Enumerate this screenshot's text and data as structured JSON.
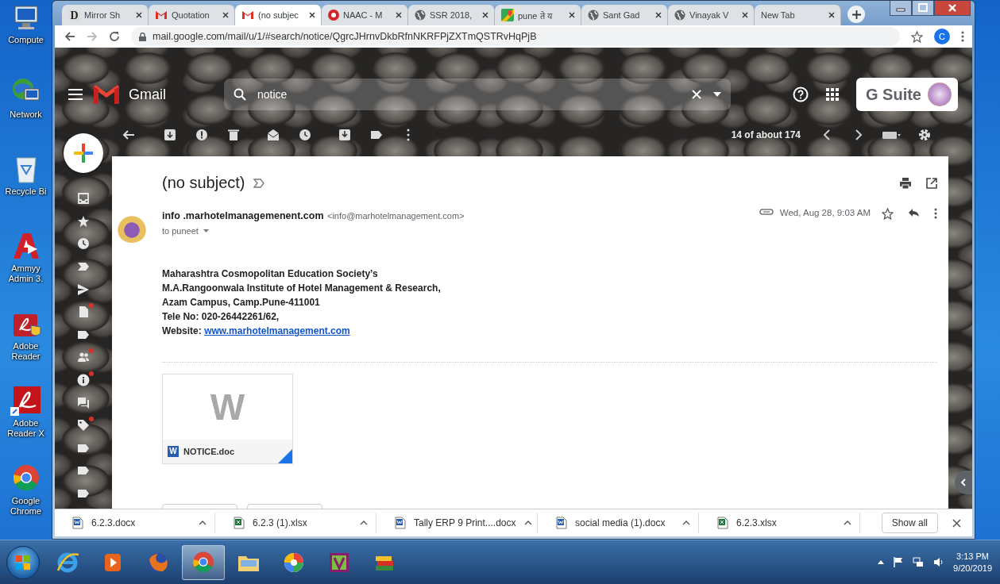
{
  "desktop_icons": [
    {
      "label": "Compute",
      "kind": "computer"
    },
    {
      "label": "Network",
      "kind": "network"
    },
    {
      "label": "Recycle Bi",
      "kind": "recycle"
    },
    {
      "label": "Ammyy Admin 3.",
      "kind": "ammyy"
    },
    {
      "label": "Adobe Reader",
      "kind": "adobe"
    },
    {
      "label": "Adobe Reader X",
      "kind": "adobe-xi"
    },
    {
      "label": "Google Chrome",
      "kind": "chrome"
    }
  ],
  "browser": {
    "tabs": [
      {
        "title": "Mirror Sh",
        "kind": "letter",
        "icon_text": "D",
        "selected": false
      },
      {
        "title": "Quotation",
        "kind": "gmail",
        "selected": false
      },
      {
        "title": "(no subjec",
        "kind": "gmail",
        "selected": true
      },
      {
        "title": "NAAC - M",
        "kind": "naac",
        "selected": false
      },
      {
        "title": "SSR 2018,",
        "kind": "globe",
        "selected": false
      },
      {
        "title": "pune ते य",
        "kind": "maps",
        "selected": false
      },
      {
        "title": "Sant Gad",
        "kind": "globe",
        "selected": false
      },
      {
        "title": "Vinayak V",
        "kind": "globe",
        "selected": false
      },
      {
        "title": "New Tab",
        "kind": "blank",
        "selected": false
      }
    ],
    "url": "mail.google.com/mail/u/1/#search/notice/QgrcJHrnvDkbRfnNKRFPjZXTmQSTRvHqPjB",
    "profile_initial": "C"
  },
  "gmail": {
    "product": "Gmail",
    "search": {
      "value": "notice"
    },
    "suite_label": "G Suite",
    "pager": "14 of about 174",
    "rail": [
      {
        "kind": "inbox",
        "badge": false
      },
      {
        "kind": "star",
        "badge": false
      },
      {
        "kind": "clock",
        "badge": false
      },
      {
        "kind": "important",
        "badge": false
      },
      {
        "kind": "send",
        "badge": false
      },
      {
        "kind": "draft",
        "badge": true
      },
      {
        "kind": "label",
        "badge": false
      },
      {
        "kind": "people",
        "badge": true
      },
      {
        "kind": "info",
        "badge": true
      },
      {
        "kind": "forum",
        "badge": false
      },
      {
        "kind": "tag",
        "badge": true
      },
      {
        "kind": "label",
        "badge": false
      },
      {
        "kind": "label",
        "badge": false
      },
      {
        "kind": "label",
        "badge": false
      }
    ],
    "message": {
      "subject": "(no subject)",
      "sender_name": "info .marhotelmanagemenent.com",
      "sender_email": "<info@marhotelmanagement.com>",
      "recipient": "to puneet",
      "date": "Wed, Aug 28, 9:03 AM",
      "body": [
        "Maharashtra Cosmopolitan Education Society’s",
        "M.A.Rangoonwala Institute of Hotel Management & Research,",
        "Azam Campus, Camp.Pune-411001",
        "Tele No: 020-26442261/62,"
      ],
      "website_label": "Website:",
      "website_link": "www.marhotelmanagement.com",
      "attachment": {
        "name": "NOTICE.doc",
        "preview_letter": "W",
        "type_letter": "W"
      }
    }
  },
  "downloads": {
    "items": [
      {
        "name": "6.2.3.docx",
        "kind": "word"
      },
      {
        "name": "6.2.3 (1).xlsx",
        "kind": "excel"
      },
      {
        "name": "Tally ERP 9 Print....docx",
        "kind": "word"
      },
      {
        "name": "social media (1).docx",
        "kind": "word"
      },
      {
        "name": "6.2.3.xlsx",
        "kind": "excel"
      }
    ],
    "show_all": "Show all"
  },
  "taskbar": {
    "apps": [
      {
        "kind": "ie",
        "active": false
      },
      {
        "kind": "media",
        "active": false
      },
      {
        "kind": "firefox",
        "active": false
      },
      {
        "kind": "chrome",
        "active": true
      },
      {
        "kind": "explorer",
        "active": false
      },
      {
        "kind": "picasa",
        "active": false
      },
      {
        "kind": "v-app",
        "active": false
      },
      {
        "kind": "books",
        "active": false
      }
    ],
    "time": "3:13 PM",
    "date": "9/20/2019"
  }
}
